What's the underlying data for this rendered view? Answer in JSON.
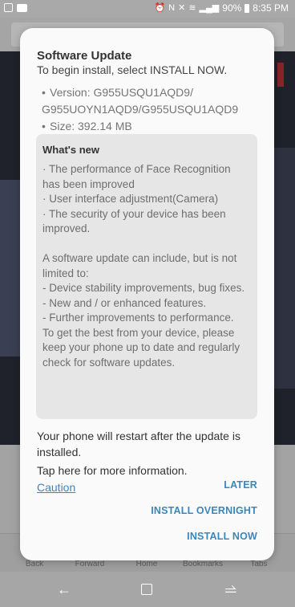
{
  "status_bar": {
    "battery": "90%",
    "time": "8:35 PM"
  },
  "background": {
    "browser_tabs": [
      "Back",
      "Forward",
      "Home",
      "Bookmarks",
      "Tabs"
    ]
  },
  "dialog": {
    "title": "Software Update",
    "subtitle": "To begin install, select INSTALL NOW.",
    "version_line1": "Version: G955USQU1AQD9/",
    "version_line2": "G955UOYN1AQD9/G955USQU1AQD9",
    "size": "Size: 392.14 MB",
    "whats_new_title": "What's new",
    "whats_new_body": "· The performance of Face Recognition has been improved\n· User interface adjustment(Camera)\n· The security of your device has been improved.\n\nA software update can include, but is not limited to:\n - Device stability improvements, bug fixes.\n - New and / or enhanced features.\n - Further improvements to performance.\nTo get the best from your device, please keep your phone up to date and regularly check for software updates.",
    "restart_note": "Your phone will restart after the update is installed.",
    "tap_info": "Tap here for more information.",
    "caution_link": "Caution",
    "actions": {
      "later": "LATER",
      "install_overnight": "INSTALL OVERNIGHT",
      "install_now": "INSTALL NOW"
    }
  },
  "colors": {
    "accent": "#3d86b8",
    "dialog_bg": "#fafafa",
    "whats_new_bg": "#e6e6e6"
  }
}
